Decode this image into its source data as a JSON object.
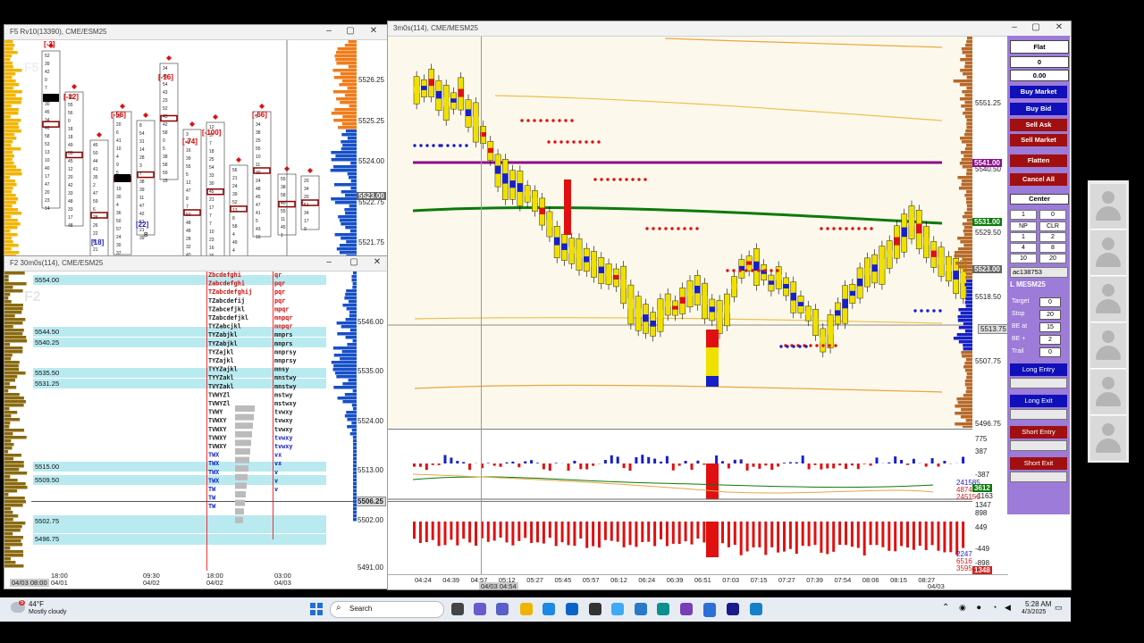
{
  "windows": {
    "top_left": {
      "title": "F5 Rv10(13390), CME/ESM25",
      "watermark": "F5",
      "prices": [
        "5526.25",
        "5525.25",
        "5524.00",
        "5522.75",
        "5521.75"
      ],
      "current_price": "5523.00",
      "deltas": [
        "[-2]",
        "[-12]",
        "[-56]",
        "[-16]",
        "[-74]",
        "[-100]",
        "[-66]",
        "[18]",
        "[22]"
      ],
      "b_label": "B"
    },
    "bottom_left": {
      "title": "F2 30m0s(114), CME/ESM25",
      "watermark": "F2",
      "levels": [
        "5554.00",
        "5544.50",
        "5540.25",
        "5535.50",
        "5531.25",
        "5515.00",
        "5509.50",
        "5502.75",
        "5496.75"
      ],
      "prices": [
        "5546.00",
        "5535.00",
        "5524.00",
        "5513.00",
        "5502.00",
        "5491.00"
      ],
      "current_price": "5506.25",
      "time_labels": [
        "18:00",
        "04/01",
        "09:30",
        "04/02",
        "18:00",
        "04/02",
        "03:00",
        "04/03"
      ],
      "time_cursor": "04/03 08:00"
    },
    "main": {
      "title": "3m0s(114), CME/MESM25",
      "prices": [
        "5551.25",
        "5540.50",
        "5529.50",
        "5518.50",
        "5507.75",
        "5496.75"
      ],
      "price_boxes": {
        "purple": "5541.00",
        "green": "5531.00",
        "current": "5523.00",
        "cursor": "5513.75"
      },
      "indicator_ticks": [
        "775",
        "387",
        "-387",
        "-1163"
      ],
      "indicator_values": [
        "241585",
        "487418",
        "245156",
        "3612"
      ],
      "volume_ticks": [
        "1347",
        "898",
        "449",
        "-449",
        "-898"
      ],
      "volume_values": [
        "2247",
        "6516",
        "3595",
        "1348"
      ],
      "time_labels": [
        "04:24",
        "04:39",
        "04:57",
        "05:12",
        "05:27",
        "05:45",
        "05:57",
        "06:12",
        "06:24",
        "06:39",
        "06:51",
        "07:03",
        "07:15",
        "07:27",
        "07:39",
        "07:54",
        "08:06",
        "08:15",
        "08:27"
      ],
      "last_date": "04/03",
      "cursor_time": "04/03 04:54",
      "b_label": "B",
      "s_label": "$"
    }
  },
  "panel": {
    "status": "Flat",
    "position": "0",
    "pnl": "0.00",
    "buttons": {
      "buy_market": "Buy Market",
      "buy_bid": "Buy Bid",
      "sell_ask": "Sell Ask",
      "sell_market": "Sell Market",
      "flatten": "Flatten",
      "cancel_all": "Cancel All",
      "center": "Center",
      "long_entry": "Long Entry",
      "long_exit": "Long Exit",
      "short_entry": "Short Entry",
      "short_exit": "Short Exit"
    },
    "qty": "1",
    "qty2": "0",
    "grid": [
      [
        "NP",
        "CLR"
      ],
      [
        "1",
        "2"
      ],
      [
        "4",
        "8"
      ],
      [
        "10",
        "20"
      ]
    ],
    "account": "ac138753",
    "symbol": "L MESM25",
    "fields": [
      {
        "label": "Target",
        "value": "0"
      },
      {
        "label": "Stop",
        "value": "20"
      },
      {
        "label": "BE at",
        "value": "15"
      },
      {
        "label": "BE +",
        "value": "2"
      },
      {
        "label": "Trail",
        "value": "0"
      }
    ]
  },
  "taskbar": {
    "temp": "44°F",
    "weather": "Mostly cloudy",
    "search": "Search",
    "time": "5:28 AM",
    "date": "4/3/2025",
    "badge": "5"
  }
}
